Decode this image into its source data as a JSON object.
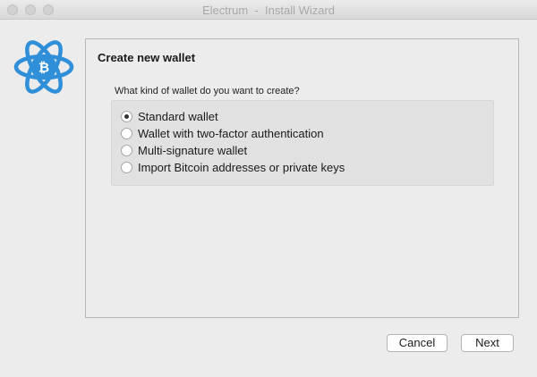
{
  "window": {
    "title": "Electrum  -  Install Wizard"
  },
  "panel": {
    "title": "Create new wallet",
    "question": "What kind of wallet do you want to create?",
    "options": [
      {
        "label": "Standard wallet",
        "selected": true
      },
      {
        "label": "Wallet with two-factor authentication",
        "selected": false
      },
      {
        "label": "Multi-signature wallet",
        "selected": false
      },
      {
        "label": "Import Bitcoin addresses or private keys",
        "selected": false
      }
    ]
  },
  "buttons": {
    "cancel_label": "Cancel",
    "next_label": "Next"
  },
  "logo": {
    "icon": "electrum-bitcoin-atom-icon",
    "color": "#2f8fd8"
  }
}
